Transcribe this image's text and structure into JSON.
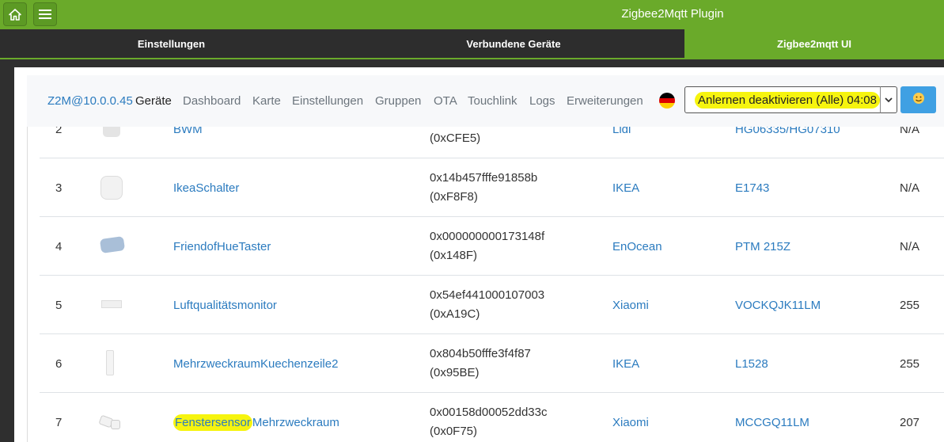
{
  "header": {
    "title": "Zigbee2Mqtt Plugin",
    "home_icon": "home-icon",
    "menu_icon": "hamburger-menu-icon"
  },
  "tabs": [
    {
      "label": "Einstellungen",
      "active": false
    },
    {
      "label": "Verbundene Geräte",
      "active": false
    },
    {
      "label": "Zigbee2mqtt UI",
      "active": true
    }
  ],
  "z2m_nav": {
    "brand": "Z2M@10.0.0.45",
    "links": [
      "Geräte",
      "Dashboard",
      "Karte",
      "Einstellungen",
      "Gruppen",
      "OTA",
      "Touchlink",
      "Logs",
      "Erweiterungen"
    ],
    "active_link": "Geräte",
    "language_flag": "de-flag-icon",
    "permit_join_label": "Anlernen deaktivieren (Alle) 04:08",
    "theme_button_icon": "smiley-face-icon"
  },
  "devices": [
    {
      "num": "2",
      "name": "BWM",
      "ieee": "",
      "nwk": "(0xCFE5)",
      "vendor": "Lidl",
      "model": "HG06335/HG07310",
      "lqi": "N/A"
    },
    {
      "num": "3",
      "name": "IkeaSchalter",
      "ieee": "0x14b457fffe91858b",
      "nwk": "(0xF8F8)",
      "vendor": "IKEA",
      "model": "E1743",
      "lqi": "N/A"
    },
    {
      "num": "4",
      "name": "FriendofHueTaster",
      "ieee": "0x000000000173148f",
      "nwk": "(0x148F)",
      "vendor": "EnOcean",
      "model": "PTM 215Z",
      "lqi": "N/A"
    },
    {
      "num": "5",
      "name": "Luftqualitätsmonitor",
      "ieee": "0x54ef441000107003",
      "nwk": "(0xA19C)",
      "vendor": "Xiaomi",
      "model": "VOCKQJK11LM",
      "lqi": "255"
    },
    {
      "num": "6",
      "name": "MehrzweckraumKuechenzeile2",
      "ieee": "0x804b50fffe3f4f87",
      "nwk": "(0x95BE)",
      "vendor": "IKEA",
      "model": "L1528",
      "lqi": "255"
    },
    {
      "num": "7",
      "name_part1": "Fenstersensor",
      "name_part2": "Mehrzweckraum",
      "ieee": "0x00158d00052dd33c",
      "nwk": "(0x0F75)",
      "vendor": "Xiaomi",
      "model": "MCCGQ11LM",
      "lqi": "207"
    }
  ],
  "colors": {
    "brand_green": "#6aaa2a",
    "dark_bg": "#2d2d2d",
    "link_blue": "#2b7bbf",
    "highlight_yellow": "#f6f40f",
    "button_blue": "#3fa0e3"
  }
}
